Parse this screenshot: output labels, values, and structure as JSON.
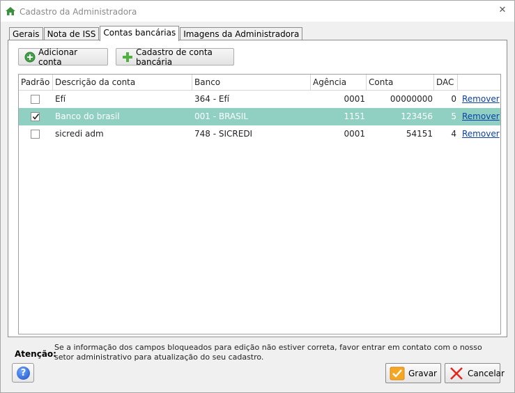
{
  "window": {
    "title": "Cadastro da Administradora",
    "close_symbol": "✕"
  },
  "tabs": [
    {
      "label": "Gerais",
      "active": false
    },
    {
      "label": "Nota de ISS",
      "active": false
    },
    {
      "label": "Contas bancárias",
      "active": true
    },
    {
      "label": "Imagens da Administradora",
      "active": false
    }
  ],
  "toolbar": {
    "add_account_label": "Adicionar conta",
    "bank_register_label": "Cadastro de conta bancária"
  },
  "grid": {
    "columns": [
      "Padrão",
      "Descrição da conta",
      "Banco",
      "Agência",
      "Conta",
      "DAC",
      ""
    ],
    "rows": [
      {
        "default": false,
        "description": "Efí",
        "bank": "364 - Efí",
        "agency": "0001",
        "account": "00000000",
        "dac": "0",
        "action": "Remover"
      },
      {
        "default": true,
        "description": "Banco do brasil",
        "bank": "001 - BRASIL",
        "agency": "1151",
        "account": "123456",
        "dac": "5",
        "action": "Remover"
      },
      {
        "default": false,
        "description": "sicredi adm",
        "bank": "748 - SICREDI",
        "agency": "0001",
        "account": "54151",
        "dac": "4",
        "action": "Remover"
      }
    ]
  },
  "footer": {
    "attention_label": "Atenção:",
    "attention_text": "Se a informação dos campos bloqueados para edição não estiver correta, favor entrar em contato com o nosso setor administrativo para atualização do seu cadastro.",
    "save_label": "Gravar",
    "cancel_label": "Cancelar",
    "help_symbol": "?"
  },
  "colors": {
    "selected_row": "#8fd0c2",
    "link": "#0a3fa8",
    "title_icon": "#3c8f3c"
  }
}
